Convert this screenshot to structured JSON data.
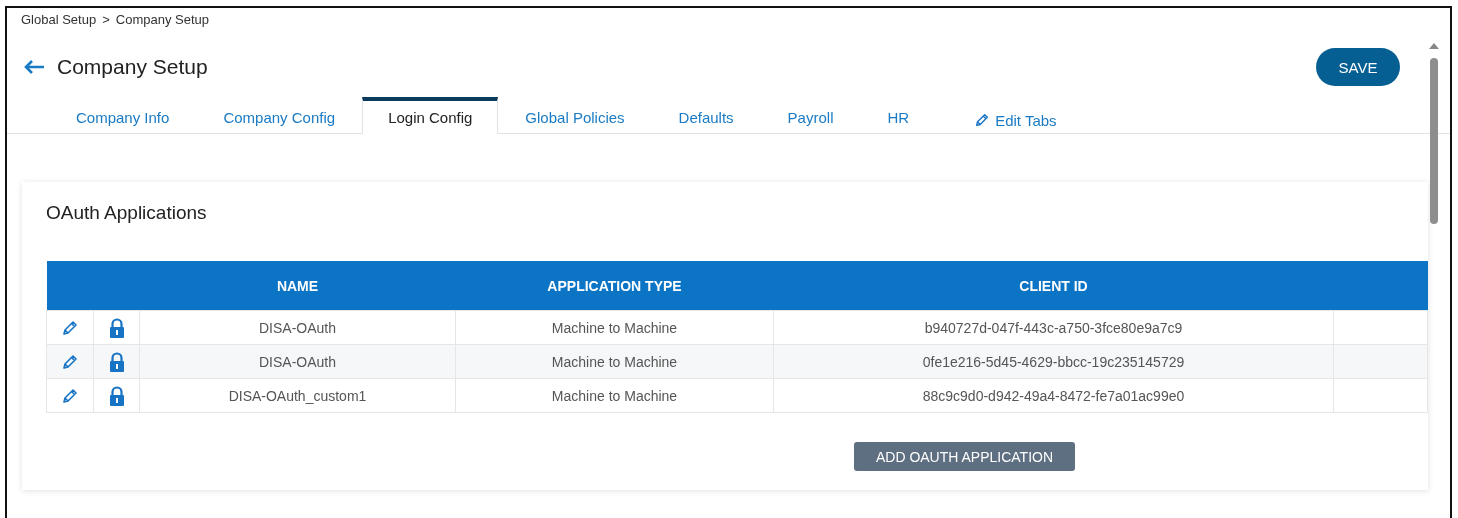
{
  "breadcrumb": [
    "Global Setup",
    "Company Setup"
  ],
  "breadcrumb_separator": ">",
  "title": "Company Setup",
  "save_button": "SAVE",
  "tabs": [
    {
      "label": "Company Info",
      "selected": false
    },
    {
      "label": "Company Config",
      "selected": false
    },
    {
      "label": "Login Config",
      "selected": true
    },
    {
      "label": "Global Policies",
      "selected": false
    },
    {
      "label": "Defaults",
      "selected": false
    },
    {
      "label": "Payroll",
      "selected": false
    },
    {
      "label": "HR",
      "selected": false
    }
  ],
  "edit_tabs": "Edit Tabs",
  "card": {
    "title": "OAuth Applications",
    "table": {
      "columns": [
        "NAME",
        "APPLICATION TYPE",
        "CLIENT ID"
      ],
      "rows": [
        {
          "name": "DISA-OAuth",
          "application_type": "Machine to Machine",
          "client_id": "b940727d-047f-443c-a750-3fce80e9a7c9"
        },
        {
          "name": "DISA-OAuth",
          "application_type": "Machine to Machine",
          "client_id": "0fe1e216-5d45-4629-bbcc-19c235145729"
        },
        {
          "name": "DISA-OAuth_custom1",
          "application_type": "Machine to Machine",
          "client_id": "88c9c9d0-d942-49a4-8472-fe7a01ac99e0"
        }
      ]
    },
    "add_button": "ADD OAUTH APPLICATION"
  }
}
